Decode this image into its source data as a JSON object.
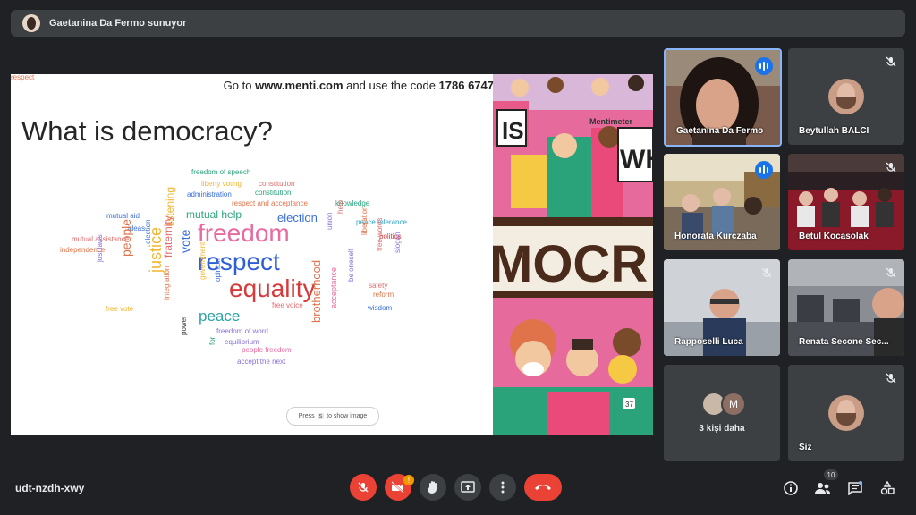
{
  "presenter": {
    "text": "Gaetanina Da Fermo sunuyor"
  },
  "slide": {
    "code_prefix": "Go to ",
    "url": "www.menti.com",
    "code_mid": " and use the code ",
    "code": "1786 6747",
    "title": "What is democracy?",
    "press_prefix": "Press",
    "press_key": "s",
    "press_suffix": "to show image",
    "art_brand": "Mentimeter",
    "art_text_is": "IS",
    "art_text_wh": "WH",
    "art_text_mocr": "MOCR",
    "count": "37"
  },
  "word_cloud": [
    {
      "text": "freedom of speech",
      "color": "#2aa37a",
      "size": 8
    },
    {
      "text": "liberty voting",
      "color": "#f2b632",
      "size": 8
    },
    {
      "text": "constitution",
      "color": "#e06c6c",
      "size": 8
    },
    {
      "text": "administration",
      "color": "#3a6fd8",
      "size": 8
    },
    {
      "text": "constitution",
      "color": "#2aa37a",
      "size": 8
    },
    {
      "text": "respect and acceptance",
      "color": "#e0734a",
      "size": 8
    },
    {
      "text": "knowledge",
      "color": "#2aa37a",
      "size": 8
    },
    {
      "text": "mutual aid",
      "color": "#3a6fd8",
      "size": 8
    },
    {
      "text": "mutual help",
      "color": "#2aa37a",
      "size": 12
    },
    {
      "text": "election",
      "color": "#3a6fd8",
      "size": 13
    },
    {
      "text": "peace tolerance",
      "color": "#2aa3c9",
      "size": 8
    },
    {
      "text": "ideas",
      "color": "#3a6fd8",
      "size": 8
    },
    {
      "text": "mutual assistance",
      "color": "#e06c6c",
      "size": 8
    },
    {
      "text": "independence",
      "color": "#e0734a",
      "size": 8
    },
    {
      "text": "freedom",
      "color": "#e86ba0",
      "size": 28
    },
    {
      "text": "politics",
      "color": "#d63a3a",
      "size": 8
    },
    {
      "text": "respect",
      "color": "#2e5fd8",
      "size": 28
    },
    {
      "text": "equality",
      "color": "#d63a3a",
      "size": 28
    },
    {
      "text": "peace",
      "color": "#2aa3a3",
      "size": 17
    },
    {
      "text": "safety",
      "color": "#e06c6c",
      "size": 8
    },
    {
      "text": "reform",
      "color": "#e0734a",
      "size": 8
    },
    {
      "text": "free voice",
      "color": "#e06c6c",
      "size": 8
    },
    {
      "text": "wisdom",
      "color": "#3a6fd8",
      "size": 8
    },
    {
      "text": "free vote",
      "color": "#f2b632",
      "size": 8
    },
    {
      "text": "freedom of word",
      "color": "#8a6fd8",
      "size": 8
    },
    {
      "text": "equilibrium",
      "color": "#8a6fd8",
      "size": 8
    },
    {
      "text": "people freedom",
      "color": "#e86ba0",
      "size": 8
    },
    {
      "text": "accept the next",
      "color": "#8a6fd8",
      "size": 8
    },
    {
      "text": "listening",
      "color": "#f2b632",
      "size": 12
    },
    {
      "text": "election",
      "color": "#3a6fd8",
      "size": 8
    },
    {
      "text": "fraternity",
      "color": "#e06c6c",
      "size": 12
    },
    {
      "text": "vote",
      "color": "#3a6fd8",
      "size": 14
    },
    {
      "text": "justice",
      "color": "#f2b632",
      "size": 18
    },
    {
      "text": "people",
      "color": "#e0734a",
      "size": 14
    },
    {
      "text": "just laws",
      "color": "#8a6fd8",
      "size": 8
    },
    {
      "text": "integration",
      "color": "#e0734a",
      "size": 8
    },
    {
      "text": "power",
      "color": "#3a3a3a",
      "size": 8
    },
    {
      "text": "government",
      "color": "#f2b632",
      "size": 8
    },
    {
      "text": "opinion",
      "color": "#3a6fd8",
      "size": 8
    },
    {
      "text": "for",
      "color": "#2aa37a",
      "size": 8
    },
    {
      "text": "union",
      "color": "#8a6fd8",
      "size": 8
    },
    {
      "text": "help",
      "color": "#e06c6c",
      "size": 8
    },
    {
      "text": "be oneself",
      "color": "#8a6fd8",
      "size": 8
    },
    {
      "text": "brotherhood",
      "color": "#e0734a",
      "size": 13
    },
    {
      "text": "acceptance",
      "color": "#e86ba0",
      "size": 9
    },
    {
      "text": "liberation",
      "color": "#e0734a",
      "size": 8
    },
    {
      "text": "free words",
      "color": "#e06c6c",
      "size": 8
    },
    {
      "text": "slogan",
      "color": "#8a6fd8",
      "size": 8
    },
    {
      "text": "respect",
      "color": "#e0734a",
      "size": 8
    }
  ],
  "participants": [
    {
      "name": "Gaetanina Da Fermo",
      "state": "speaking"
    },
    {
      "name": "Beytullah BALCI",
      "state": "muted"
    },
    {
      "name": "Honorata Kurczaba",
      "state": "speaking"
    },
    {
      "name": "Betul Kocasolak",
      "state": "muted"
    },
    {
      "name": "Rapposelli Luca",
      "state": "muted"
    },
    {
      "name": "Renata Secone Sec...",
      "state": "muted"
    }
  ],
  "more_tile": {
    "initial": "M",
    "label": "3 kişi daha"
  },
  "self_tile": {
    "label": "Siz"
  },
  "meeting_code": "udt-nzdh-xwy",
  "badges": {
    "alerts": "!",
    "participants_count": "10"
  },
  "colors": {
    "background": "#202124",
    "accent": "#1a73e8",
    "danger": "#ea4335",
    "bar": "#3c4043"
  }
}
